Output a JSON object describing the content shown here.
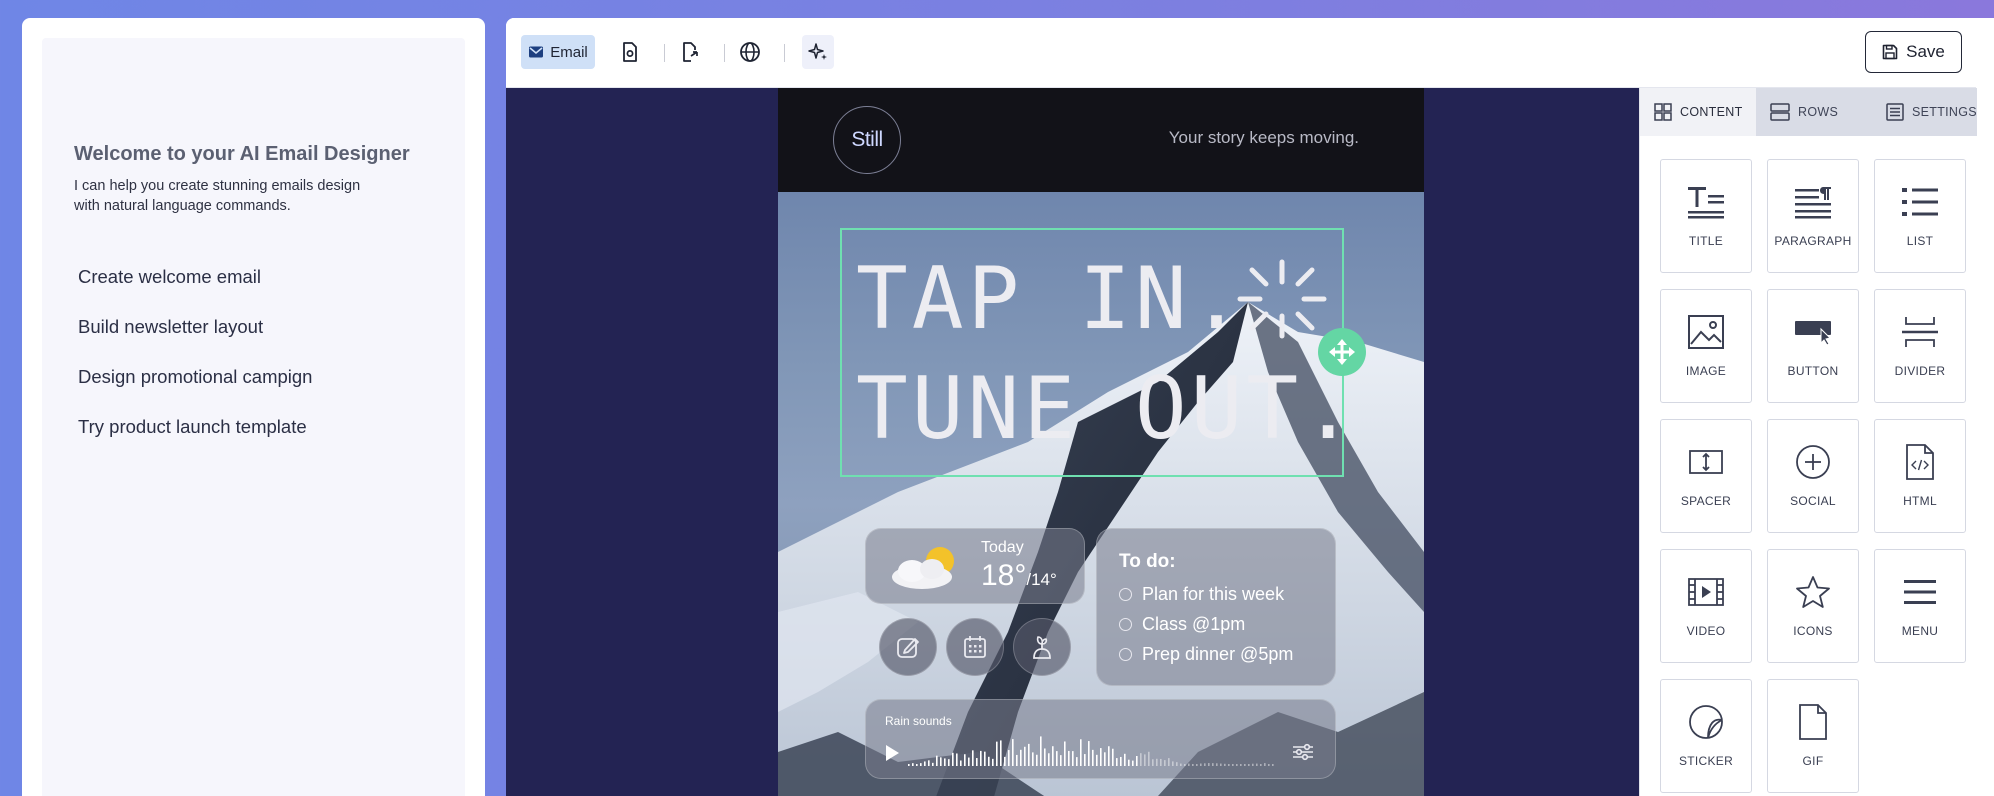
{
  "ai_panel": {
    "title": "Welcome to your AI Email Designer",
    "description": "I can help you create stunning emails design with natural language commands.",
    "suggestions": [
      "Create welcome email",
      "Build newsletter layout",
      "Design promotional campign",
      "Try product launch template"
    ]
  },
  "toolbar": {
    "email_label": "Email",
    "save_label": "Save"
  },
  "email": {
    "logo_text": "Still",
    "tagline": "Your story keeps moving.",
    "headline_line1": "TAP IN.",
    "headline_line2": "TUNE OUT.",
    "weather": {
      "day": "Today",
      "high": "18°",
      "low": "/14°"
    },
    "todo": {
      "title": "To do:",
      "items": [
        "Plan for this week",
        "Class @1pm",
        "Prep dinner @5pm"
      ]
    },
    "rain_label": "Rain sounds"
  },
  "side_panel": {
    "tabs": [
      "CONTENT",
      "ROWS",
      "SETTINGS"
    ],
    "tiles": [
      "TITLE",
      "PARAGRAPH",
      "LIST",
      "IMAGE",
      "BUTTON",
      "DIVIDER",
      "SPACER",
      "SOCIAL",
      "HTML",
      "VIDEO",
      "ICONS",
      "MENU",
      "STICKER",
      "GIF"
    ]
  },
  "colors": {
    "accent_green": "#6fe0b0",
    "canvas_bg": "#232353",
    "email_tab_bg": "#cfe0f7"
  }
}
